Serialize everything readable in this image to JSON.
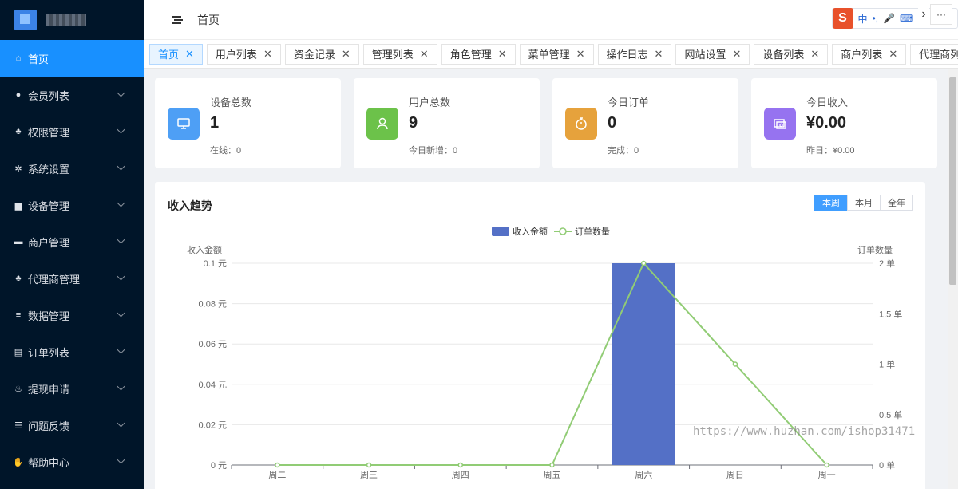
{
  "sidebar": {
    "items": [
      {
        "label": "首页",
        "icon": "home-icon",
        "glyph": "⌂",
        "active": true
      },
      {
        "label": "会员列表",
        "icon": "user-circle-icon",
        "glyph": "●"
      },
      {
        "label": "权限管理",
        "icon": "users-cog-icon",
        "glyph": "♣"
      },
      {
        "label": "系统设置",
        "icon": "cogs-icon",
        "glyph": "✲"
      },
      {
        "label": "设备管理",
        "icon": "briefcase-icon",
        "glyph": "▆"
      },
      {
        "label": "商户管理",
        "icon": "store-icon",
        "glyph": "▬"
      },
      {
        "label": "代理商管理",
        "icon": "users-icon",
        "glyph": "♣"
      },
      {
        "label": "数据管理",
        "icon": "database-icon",
        "glyph": "≡"
      },
      {
        "label": "订单列表",
        "icon": "clipboard-icon",
        "glyph": "▤"
      },
      {
        "label": "提现申请",
        "icon": "money-bag-icon",
        "glyph": "♨"
      },
      {
        "label": "问题反馈",
        "icon": "list-icon",
        "glyph": "☰"
      },
      {
        "label": "帮助中心",
        "icon": "handshake-icon",
        "glyph": "✋"
      }
    ]
  },
  "header": {
    "breadcrumb": "首页",
    "ime_label": "中",
    "ime_logo": "S"
  },
  "tabs": [
    "首页",
    "用户列表",
    "资金记录",
    "管理列表",
    "角色管理",
    "菜单管理",
    "操作日志",
    "网站设置",
    "设备列表",
    "商户列表",
    "代理商列表"
  ],
  "tabs_more": "···",
  "tabs_next": "›",
  "stats": [
    {
      "label": "设备总数",
      "value": "1",
      "sub": "在线：0",
      "icon": "monitor-icon",
      "color": "#4e9ff5"
    },
    {
      "label": "用户总数",
      "value": "9",
      "sub": "今日新增：0",
      "icon": "user-icon",
      "color": "#6cc24a"
    },
    {
      "label": "今日订单",
      "value": "0",
      "sub": "完成：0",
      "icon": "stopwatch-icon",
      "color": "#e6a23c"
    },
    {
      "label": "今日收入",
      "value": "¥0.00",
      "sub": "昨日：¥0.00",
      "icon": "cash-icon",
      "color": "#9673f0"
    }
  ],
  "chart_card": {
    "title": "收入趋势",
    "periods": [
      "本周",
      "本月",
      "全年"
    ],
    "selected_period": "本周"
  },
  "chart_data": {
    "type": "bar",
    "categories": [
      "周二",
      "周三",
      "周四",
      "周五",
      "周六",
      "周日",
      "周一"
    ],
    "series": [
      {
        "name": "收入金额",
        "type": "bar",
        "axis": "left",
        "values": [
          0,
          0,
          0,
          0,
          0.1,
          0,
          0
        ],
        "color": "#5470c6"
      },
      {
        "name": "订单数量",
        "type": "line",
        "axis": "right",
        "values": [
          0,
          0,
          0,
          0,
          2,
          1,
          0
        ],
        "color": "#91cc75"
      }
    ],
    "ylabel": "收入金额",
    "ylabel_right": "订单数量",
    "ylim": [
      0,
      0.1
    ],
    "ylim_right": [
      0,
      2
    ],
    "yticks": [
      "0 元",
      "0.02 元",
      "0.04 元",
      "0.06 元",
      "0.08 元",
      "0.1 元"
    ],
    "yticks_right": [
      "0 单",
      "0.5 单",
      "1 单",
      "1.5 单",
      "2 单"
    ],
    "legend": "top-center",
    "grid": true
  },
  "watermark": "https://www.huzhan.com/ishop31471"
}
